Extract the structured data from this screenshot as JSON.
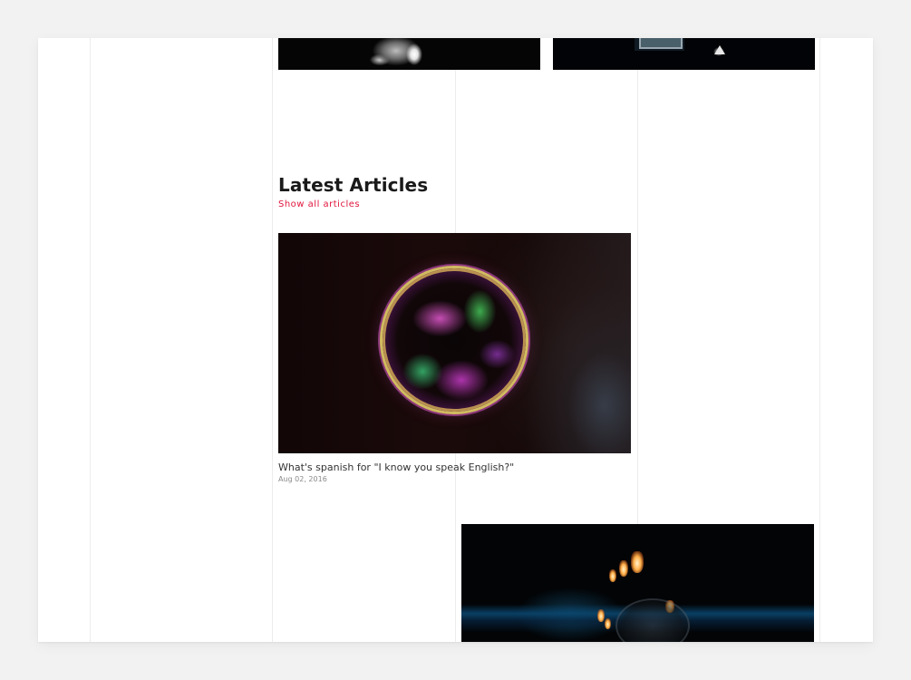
{
  "latest_articles": {
    "heading": "Latest Articles",
    "show_all_label": "Show all articles"
  },
  "articles": [
    {
      "title": "What's spanish for \"I know you speak English?\"",
      "date": "Aug 02, 2016"
    }
  ],
  "colors": {
    "page_background": "#f2f2f2",
    "card_background": "#ffffff",
    "accent_link": "#e0163d",
    "heading_text": "#1a1a1a",
    "meta_text": "#8a8a8a"
  }
}
